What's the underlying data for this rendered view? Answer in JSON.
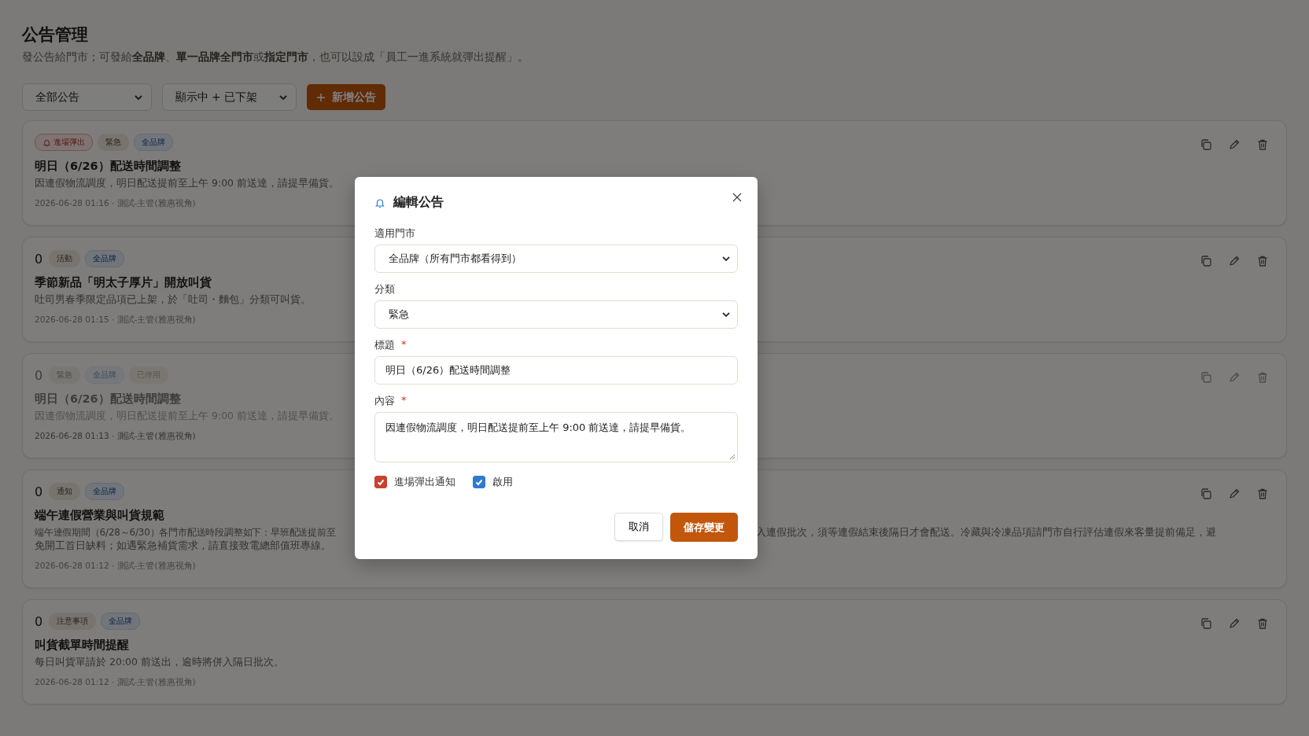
{
  "page": {
    "title": "公告管理",
    "subtitle": "發公告給門市；可發給**全品牌**、**單一品牌全門市**或**指定門市**，也可以設成「員工一進系統就彈出提醒」。"
  },
  "filters": [
    {
      "value": "全部公告"
    },
    {
      "value": "顯示中 + 已下架"
    }
  ],
  "new_button": {
    "label": "新增公告"
  },
  "announcements": [
    {
      "disabled": false,
      "tags": [
        {
          "label": "進場彈出",
          "kind": "popup"
        },
        {
          "label": "緊急",
          "kind": "category"
        },
        {
          "label": "全品牌",
          "kind": "brand"
        }
      ],
      "title": "明日（6/26）配送時間調整",
      "body": "因連假物流調度，明日配送提前至上午 9:00 前送達，請提早備貨。",
      "meta": "2026-06-28 01:16 · 測試-主管(雅惠視角)"
    },
    {
      "count": "0",
      "disabled": false,
      "tags": [
        {
          "label": "活動",
          "kind": "category"
        },
        {
          "label": "全品牌",
          "kind": "brand"
        }
      ],
      "title": "季節新品「明太子厚片」開放叫貨",
      "body": "吐司男春季限定品項已上架，於「吐司・麵包」分類可叫貨。",
      "meta": "2026-06-28 01:15 · 測試-主管(雅惠視角)"
    },
    {
      "count": "0",
      "disabled": true,
      "tags": [
        {
          "label": "緊急",
          "kind": "category"
        },
        {
          "label": "全品牌",
          "kind": "brand"
        },
        {
          "label": "已停用",
          "kind": "status"
        }
      ],
      "title": "明日（6/26）配送時間調整",
      "body": "因連假物流調度，明日配送提前至上午 9:00 前送達，請提早備貨。",
      "meta": "2026-06-28 01:13 · 測試-主管(雅惠視角)"
    },
    {
      "count": "0",
      "disabled": false,
      "tags": [
        {
          "label": "通知",
          "kind": "category"
        },
        {
          "label": "全品牌",
          "kind": "brand"
        }
      ],
      "title": "端午連假營業與叫貨規範",
      "body_parts": [
        "端午連假期間（6/28～6/30）各門市配送時段調整如下：早班配送提前至",
        "入連假批次，須等連假結束後隔日才會配送。冷藏與冷凍品項請門市自行評估連假來客量提前備足，避",
        "免開工首日缺料；如遇緊急補貨需求，請直接致電總部值班專線。"
      ],
      "meta": "2026-06-28 01:12 · 測試-主管(雅惠視角)"
    },
    {
      "count": "0",
      "disabled": false,
      "tags": [
        {
          "label": "注意事項",
          "kind": "category"
        },
        {
          "label": "全品牌",
          "kind": "brand"
        }
      ],
      "title": "叫貨截單時間提醒",
      "body": "每日叫貨單請於 20:00 前送出，逾時將併入隔日批次。",
      "meta": "2026-06-28 01:12 · 測試-主管(雅惠視角)"
    }
  ],
  "dialog": {
    "title": "編輯公告",
    "fields": [
      {
        "label": "適用門市",
        "kind": "select",
        "value": "全品牌（所有門市都看得到）"
      },
      {
        "label": "分類",
        "kind": "select",
        "value": "緊急"
      },
      {
        "label": "標題",
        "required_mark": "*",
        "kind": "input",
        "value": "明日（6/26）配送時間調整"
      },
      {
        "label": "內容",
        "required_mark": "*",
        "kind": "textarea",
        "value": "因連假物流調度，明日配送提前至上午 9:00 前送達，請提早備貨。"
      }
    ],
    "checkboxes": [
      {
        "label": "進場彈出通知",
        "checked": true,
        "color": "#c8412e"
      },
      {
        "label": "啟用",
        "checked": true,
        "color": "#2f7bd0"
      }
    ],
    "cancel_button": "取消",
    "save_button": "儲存變更"
  }
}
